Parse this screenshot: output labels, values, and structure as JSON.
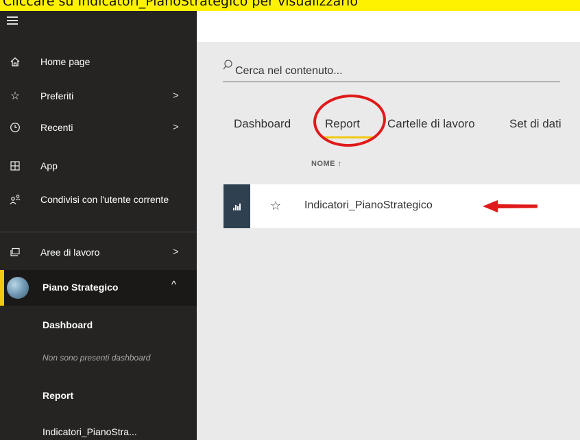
{
  "banner": {
    "text": "Cliccare su Indicatori_PianoStrategico per visualizzarlo"
  },
  "sidebar": {
    "items": [
      {
        "icon": "home-icon",
        "label": "Home page",
        "has_chevron": false
      },
      {
        "icon": "star-icon",
        "label": "Preferiti",
        "has_chevron": true
      },
      {
        "icon": "clock-icon",
        "label": "Recenti",
        "has_chevron": true
      },
      {
        "icon": "apps-icon",
        "label": "App",
        "has_chevron": false
      },
      {
        "icon": "shared-users-icon",
        "label": "Condivisi con l'utente corrente",
        "has_chevron": false
      },
      {
        "icon": "workspaces-icon",
        "label": "Aree di lavoro",
        "has_chevron": true
      }
    ],
    "workspace": {
      "title": "Piano Strategico",
      "caret": "^",
      "sections": {
        "dashboard_header": "Dashboard",
        "dashboard_empty": "Non sono presenti dashboard",
        "report_header": "Report",
        "report_item": "Indicatori_PianoStra..."
      }
    },
    "chevron": ">"
  },
  "main": {
    "search": {
      "placeholder": "Cerca nel contenuto..."
    },
    "tabs": [
      "Dashboard",
      "Report",
      "Cartelle di lavoro",
      "Set di dati"
    ],
    "active_tab": "Report",
    "column_header": "NOME ↑",
    "rows": [
      {
        "name": "Indicatori_PianoStrategico",
        "star": "☆"
      }
    ]
  },
  "colors": {
    "sidebar_bg": "#252423",
    "accent": "#f2c811",
    "annotation": "#e01a1a",
    "report_icon_bg": "#2f4050"
  }
}
